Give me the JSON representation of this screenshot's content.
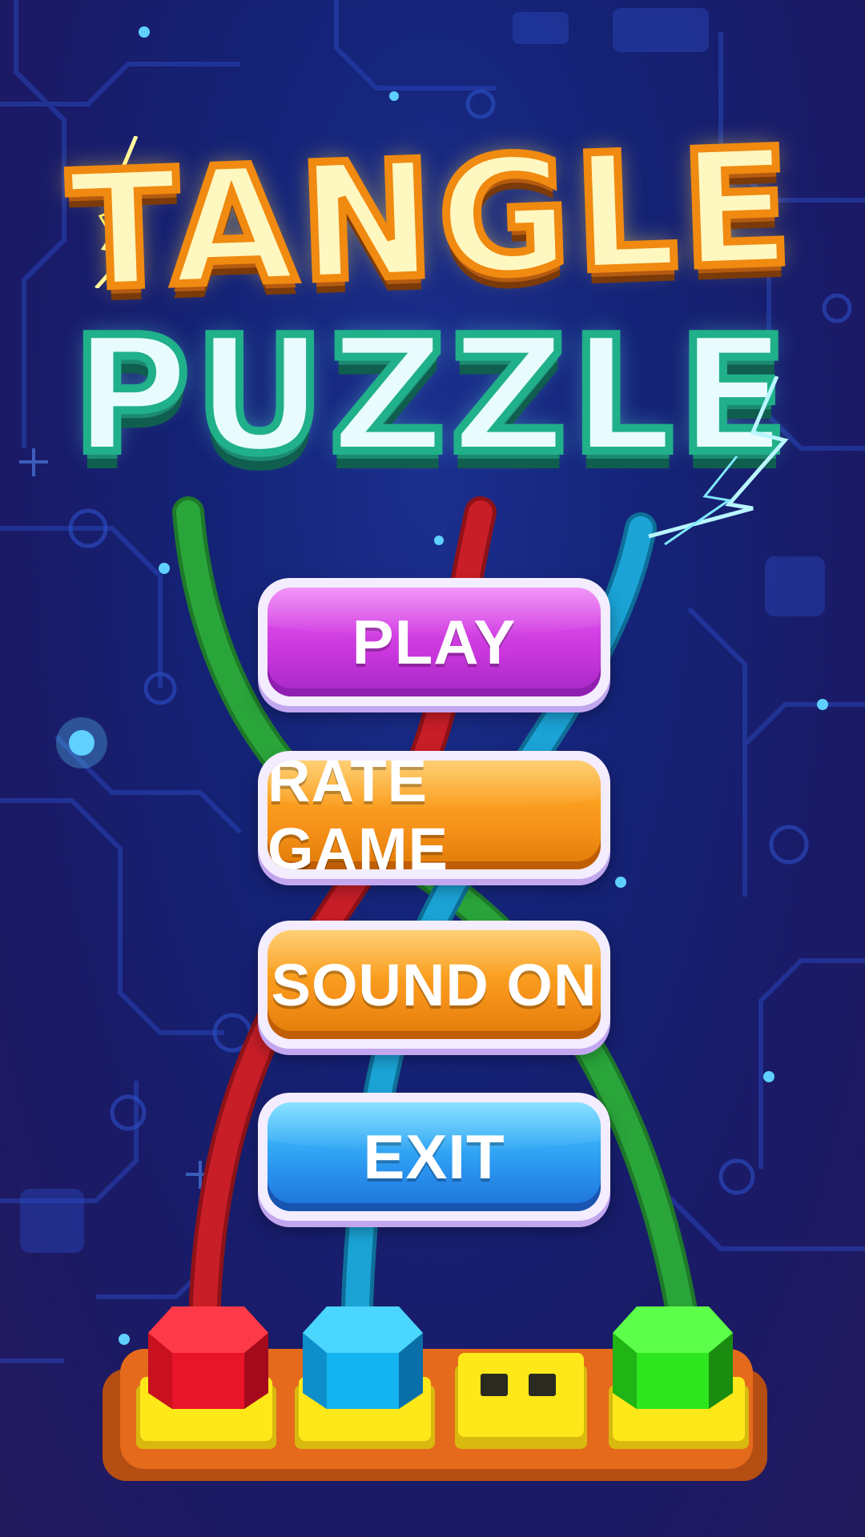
{
  "title": {
    "line1": "TANGLE",
    "line2": "PUZZLE"
  },
  "menu": {
    "play": "PLAY",
    "rate": "RATE GAME",
    "sound": "SOUND ON",
    "exit": "EXIT"
  },
  "colors": {
    "play": "#d23fe5",
    "rate": "#f7931a",
    "sound": "#f7931a",
    "exit": "#2a96f0",
    "wire_red": "#c81e28",
    "wire_blue": "#1ba3d6",
    "wire_green": "#2aa53a",
    "plug_red": "#e8142a",
    "plug_blue": "#14b4f0",
    "plug_green": "#2ee61e",
    "power_strip": "#e56a1c",
    "socket": "#ffe81a"
  },
  "plugs": [
    "plug-red",
    "plug-blue",
    "empty-socket",
    "plug-green"
  ]
}
